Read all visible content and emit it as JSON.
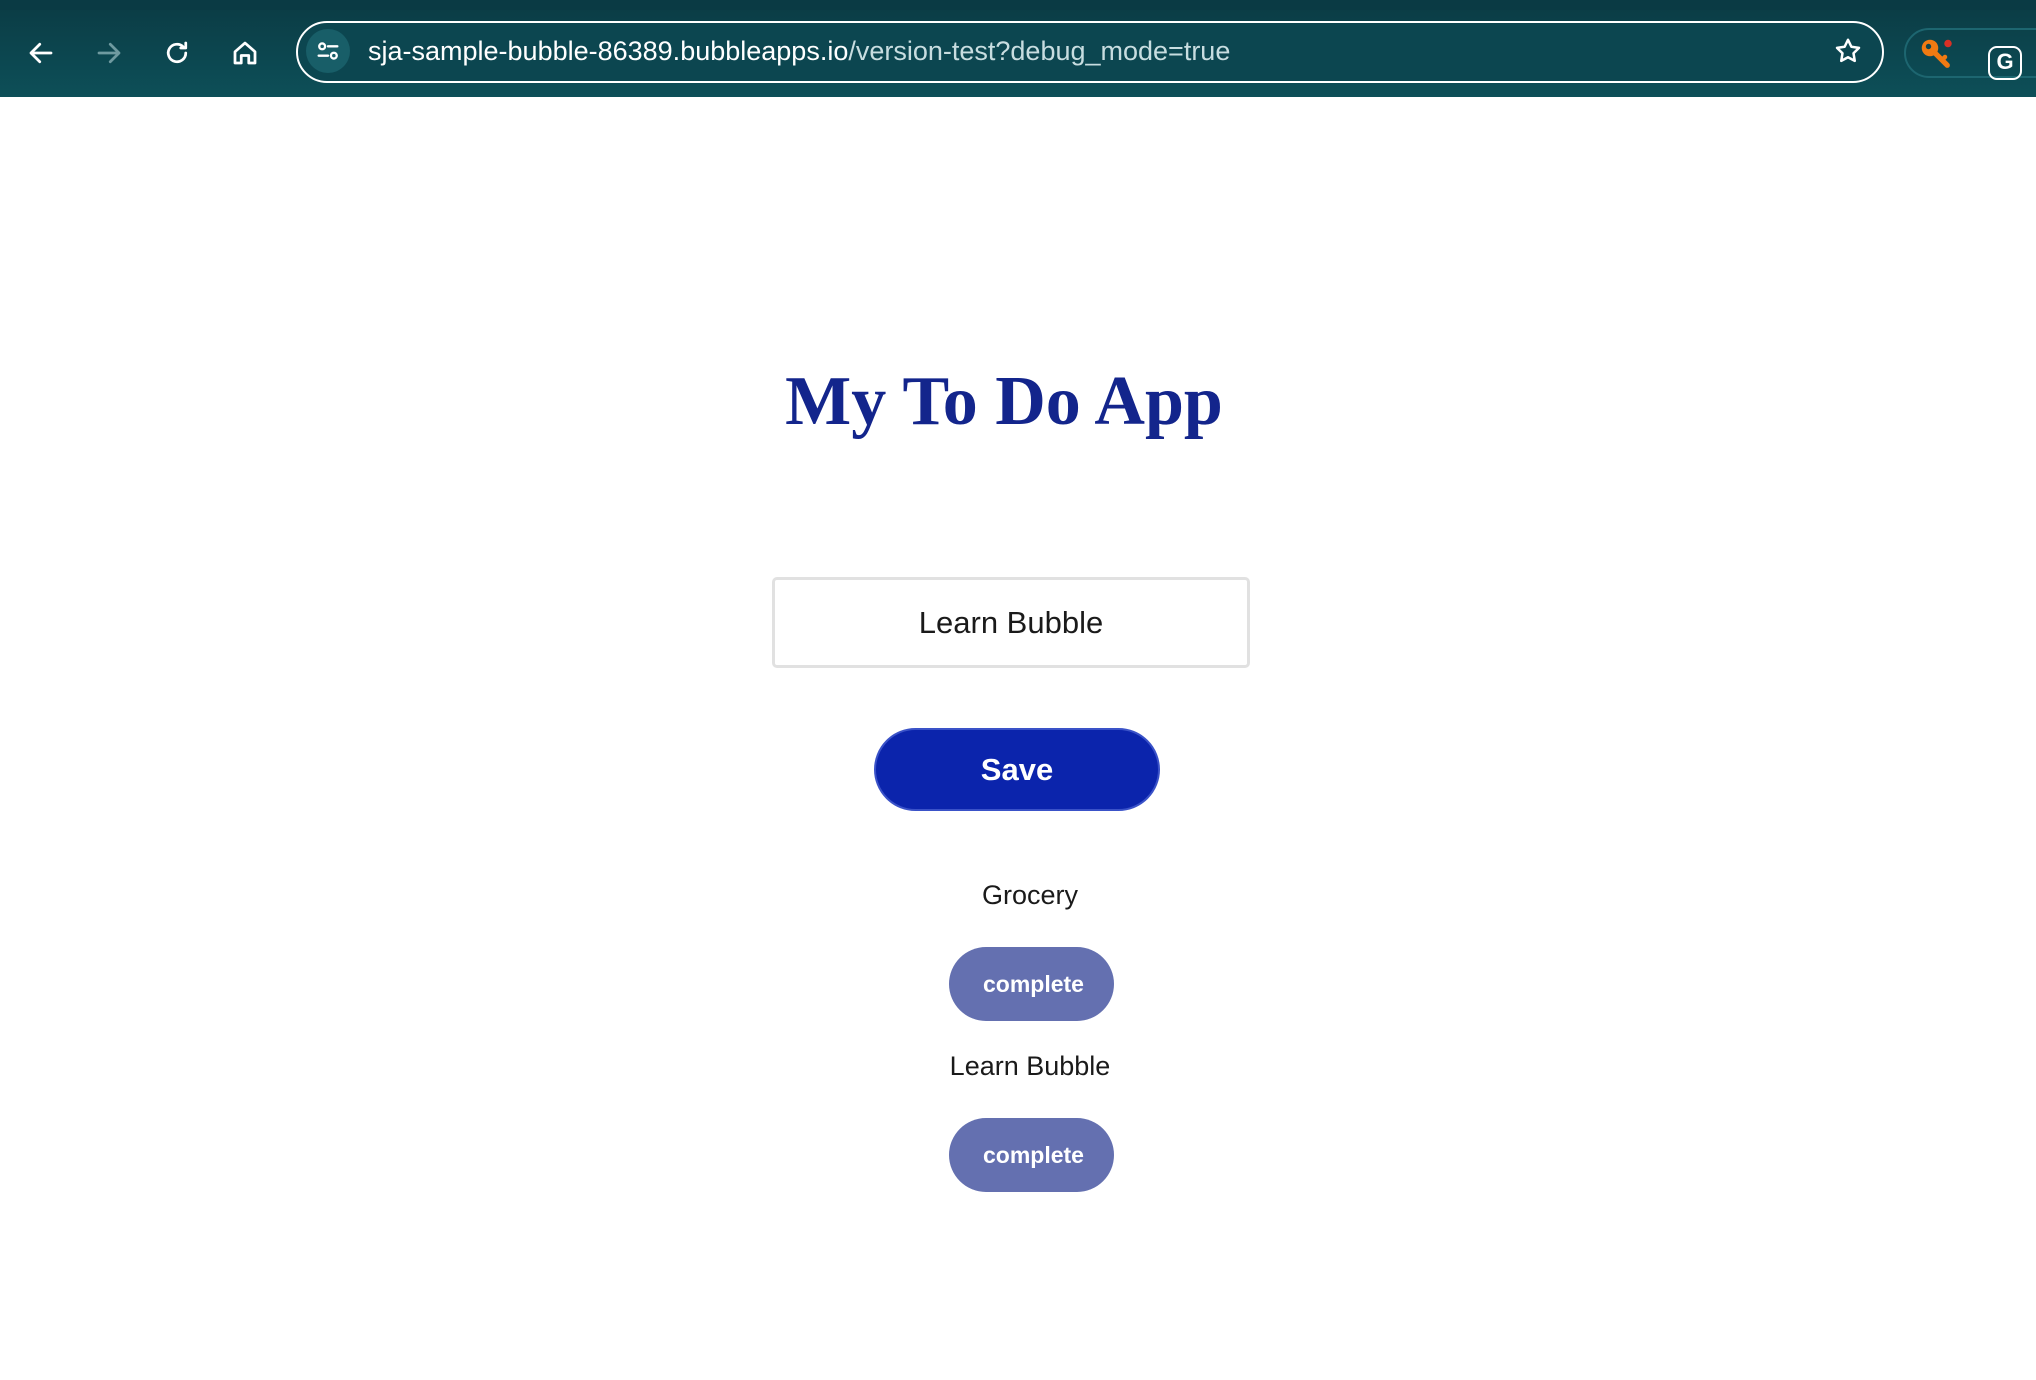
{
  "browser": {
    "url_host": "sja-sample-bubble-86389.bubbleapps.io",
    "url_path": "/version-test?debug_mode=true",
    "extension_g_label": "G"
  },
  "app": {
    "title": "My To Do App",
    "input_value": "Learn Bubble",
    "save_label": "Save",
    "todos": [
      {
        "label": "Grocery",
        "button_label": "complete"
      },
      {
        "label": "Learn Bubble",
        "button_label": "complete"
      }
    ]
  },
  "colors": {
    "title": "#13258c",
    "save_button": "#0b24ac",
    "complete_button": "#6470b0",
    "browser_bar": "#0d4f58"
  }
}
